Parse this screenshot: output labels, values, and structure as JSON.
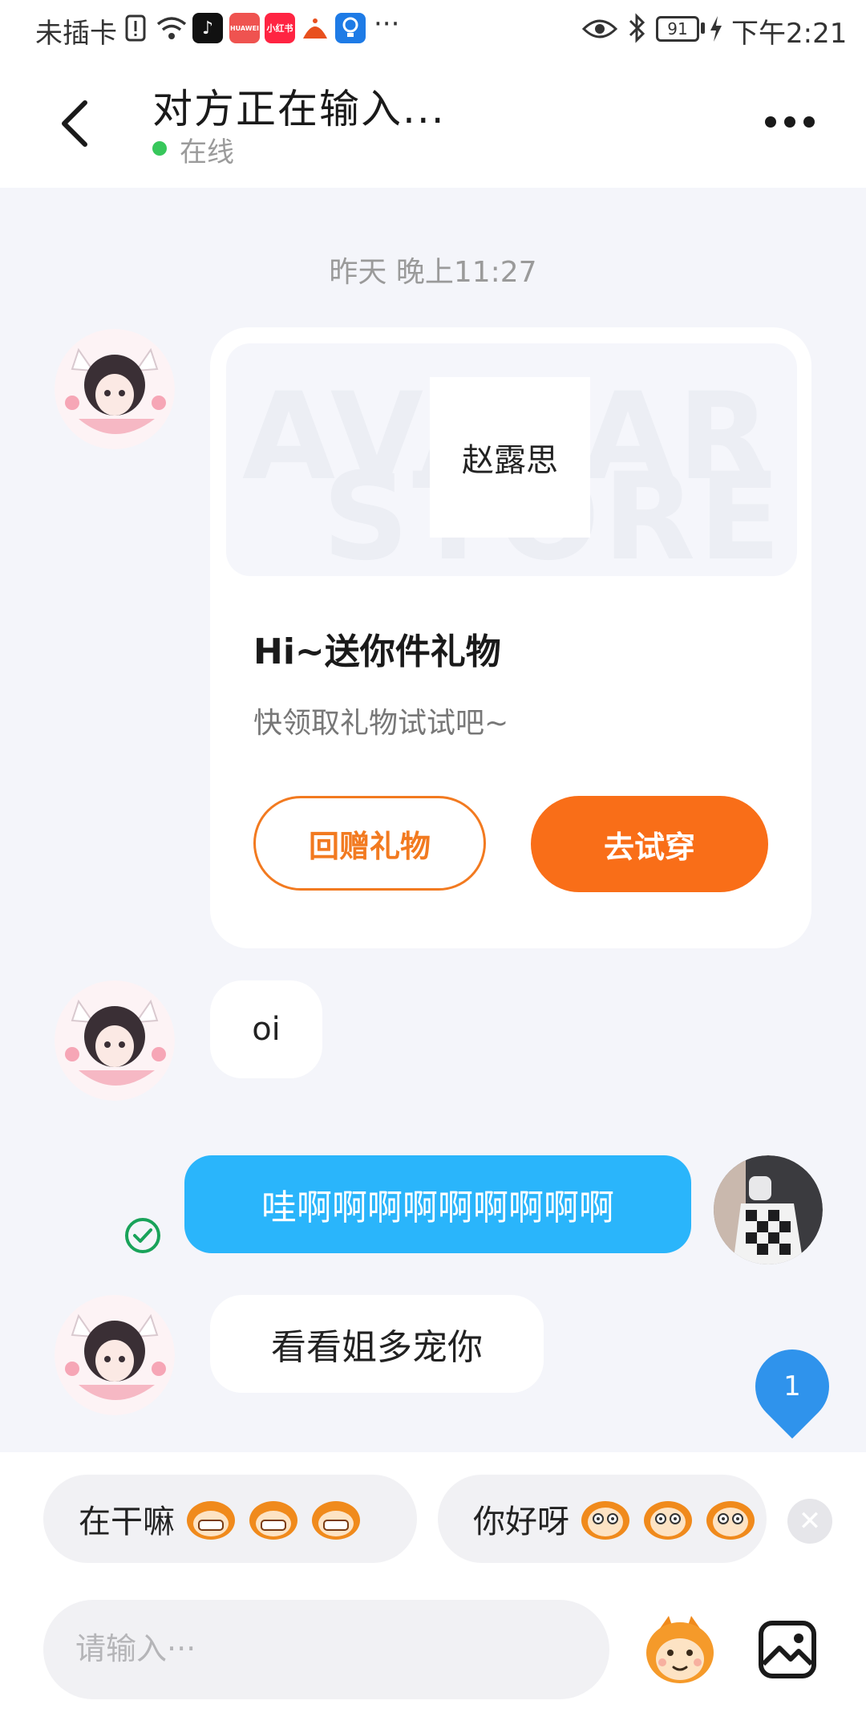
{
  "status_bar": {
    "carrier": "未插卡",
    "app_badges": [
      "抖音",
      "HUAWEI",
      "小红书",
      "",
      ""
    ],
    "more": "···",
    "battery": "91",
    "time": "下午2:21"
  },
  "header": {
    "title": "对方正在输入...",
    "status": "在线"
  },
  "chat": {
    "timestamp": "昨天 晚上11:27",
    "gift_card": {
      "watermark_top": "AVATAR",
      "watermark_bottom": "STORE",
      "name": "赵露思",
      "title": "Hi~送你件礼物",
      "subtitle": "快领取礼物试试吧~",
      "return_gift_label": "回赠礼物",
      "try_on_label": "去试穿"
    },
    "messages": [
      {
        "from": "other",
        "text": "oi"
      },
      {
        "from": "me",
        "text": "哇啊啊啊啊啊啊啊啊啊"
      },
      {
        "from": "other",
        "text": "看看姐多宠你"
      }
    ],
    "unread_count": "1"
  },
  "quick_replies": [
    {
      "text": "在干嘛"
    },
    {
      "text": "你好呀"
    }
  ],
  "input": {
    "placeholder": "请输入···"
  },
  "colors": {
    "accent_orange": "#f96e18",
    "my_bubble": "#2ab5fb",
    "online": "#37c75b",
    "read_check": "#19a35a"
  }
}
